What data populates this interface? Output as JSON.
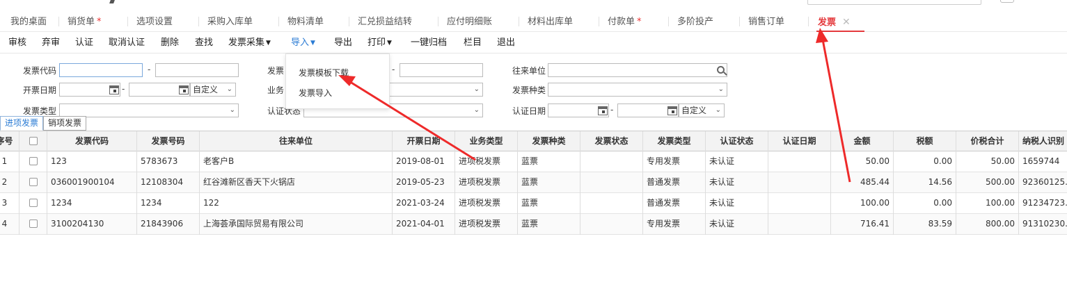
{
  "tabs": [
    {
      "label": "我的桌面",
      "star": ""
    },
    {
      "label": "销货单",
      "star": "*"
    },
    {
      "label": "选项设置",
      "star": ""
    },
    {
      "label": "采购入库单",
      "star": ""
    },
    {
      "label": "物料清单",
      "star": ""
    },
    {
      "label": "汇兑损益结转",
      "star": ""
    },
    {
      "label": "应付明细账",
      "star": ""
    },
    {
      "label": "材料出库单",
      "star": ""
    },
    {
      "label": "付款单",
      "star": "*"
    },
    {
      "label": "多阶投产",
      "star": ""
    },
    {
      "label": "销售订单",
      "star": ""
    },
    {
      "label": "发票",
      "star": "",
      "close": "✕"
    }
  ],
  "toolbar": {
    "audit": "审核",
    "unaudit": "弃审",
    "certify": "认证",
    "uncertify": "取消认证",
    "delete": "删除",
    "find": "查找",
    "collect": "发票采集",
    "import": "导入",
    "export": "导出",
    "print": "打印",
    "archive": "一键归档",
    "columns": "栏目",
    "exit": "退出"
  },
  "import_menu": {
    "template": "发票模板下载",
    "import": "发票导入"
  },
  "filters": {
    "invoice_code": "发票代码",
    "invoice_no": "发票",
    "partner": "往来单位",
    "issue_date": "开票日期",
    "business_type": "业务",
    "invoice_kind": "发票种类",
    "invoice_type": "发票类型",
    "cert_status": "认证状态",
    "cert_date": "认证日期",
    "custom": "自定义",
    "dash": "-"
  },
  "subtabs": {
    "input": "进项发票",
    "output": "销项发票"
  },
  "table": {
    "headers": [
      "序号",
      "",
      "发票代码",
      "发票号码",
      "往来单位",
      "开票日期",
      "业务类型",
      "发票种类",
      "发票状态",
      "发票类型",
      "认证状态",
      "认证日期",
      "金额",
      "税额",
      "价税合计",
      "纳税人识别"
    ],
    "rows": [
      [
        "1",
        "",
        "123",
        "5783673",
        "老客户B",
        "2019-08-01",
        "进项税发票",
        "蓝票",
        "",
        "专用发票",
        "未认证",
        "",
        "50.00",
        "0.00",
        "50.00",
        "1659744"
      ],
      [
        "2",
        "",
        "036001900104",
        "12108304",
        "红谷滩新区香天下火锅店",
        "2019-05-23",
        "进项税发票",
        "蓝票",
        "",
        "普通发票",
        "未认证",
        "",
        "485.44",
        "14.56",
        "500.00",
        "92360125..."
      ],
      [
        "3",
        "",
        "1234",
        "1234",
        "122",
        "2021-03-24",
        "进项税发票",
        "蓝票",
        "",
        "普通发票",
        "未认证",
        "",
        "100.00",
        "0.00",
        "100.00",
        "91234723..."
      ],
      [
        "4",
        "",
        "3100204130",
        "21843906",
        "上海荟承国际贸易有限公司",
        "2021-04-01",
        "进项税发票",
        "蓝票",
        "",
        "专用发票",
        "未认证",
        "",
        "716.41",
        "83.59",
        "800.00",
        "91310230..."
      ]
    ]
  },
  "colors": {
    "accent_red": "#e4393c",
    "link_blue": "#2a7bd4",
    "arrow_red": "#ee2a2a"
  }
}
